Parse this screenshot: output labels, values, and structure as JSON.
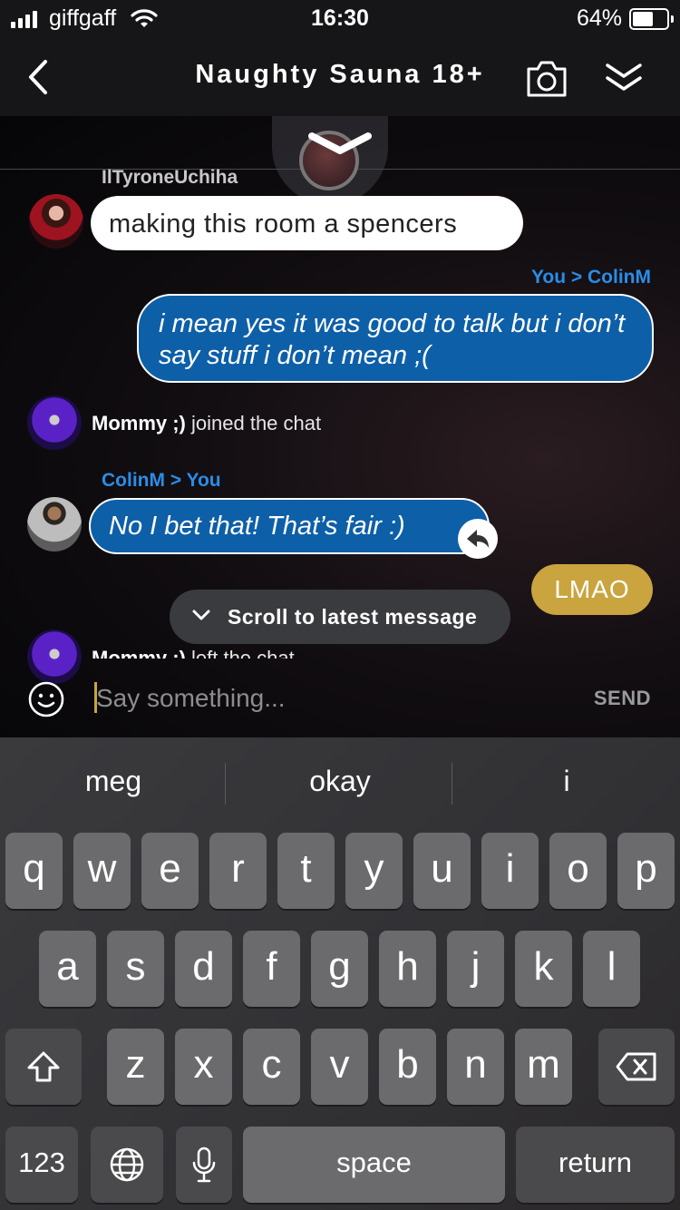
{
  "status_bar": {
    "carrier": "giffgaff",
    "time": "16:30",
    "battery_percent": "64%",
    "battery_level": 0.64,
    "signal_bars": 4
  },
  "header": {
    "title": "Naughty Sauna 18+",
    "back_icon": "chevron-left-icon",
    "camera_icon": "camera-icon",
    "collapse_icon": "double-chevron-down-icon"
  },
  "chat": {
    "messages": [
      {
        "sender": "IlTyroneUchiha",
        "text": "making this room a spencers"
      },
      {
        "sender": "You > ColinM",
        "text": "i mean yes it was good to talk but i don’t say stuff i don’t mean ;("
      },
      {
        "system_user": "Mommy ;)",
        "system_text": " joined the chat"
      },
      {
        "sender": "ColinM > You",
        "text": "No I bet that! That’s fair :)"
      },
      {
        "text": "LMAO"
      },
      {
        "system_user": "Mommy ;)",
        "system_text": " left the chat"
      }
    ],
    "scroll_button_label": "Scroll to latest message"
  },
  "composer": {
    "placeholder": "Say something...",
    "send_label": "SEND"
  },
  "keyboard": {
    "suggestions": [
      "meg",
      "okay",
      "i"
    ],
    "row1": [
      "q",
      "w",
      "e",
      "r",
      "t",
      "y",
      "u",
      "i",
      "o",
      "p"
    ],
    "row2": [
      "a",
      "s",
      "d",
      "f",
      "g",
      "h",
      "j",
      "k",
      "l"
    ],
    "row3": [
      "z",
      "x",
      "c",
      "v",
      "b",
      "n",
      "m"
    ],
    "numbers_label": "123",
    "space_label": "space",
    "return_label": "return"
  },
  "colors": {
    "accent_gold": "#c9a43f",
    "bubble_blue": "#0d5fa8",
    "name_blue": "#2a8de8"
  }
}
